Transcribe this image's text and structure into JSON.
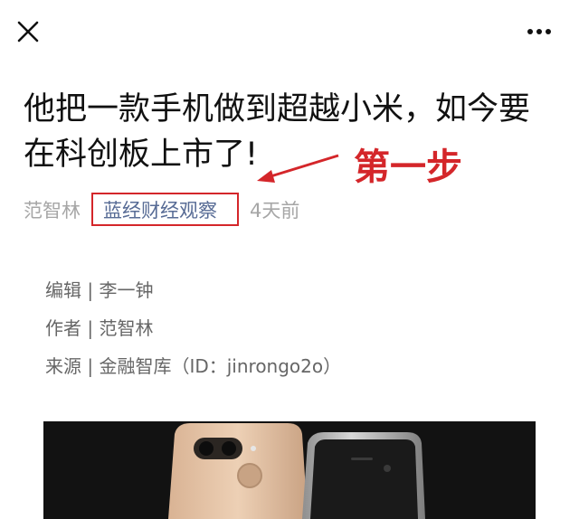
{
  "article": {
    "title": "他把一款手机做到超越小米，如今要在科创板上市了!",
    "author": "范智林",
    "account": "蓝经财经观察",
    "time": "4天前",
    "credits": [
      "编辑 | 李一钟",
      "作者 | 范智林",
      "来源 | 金融智库（ID：jinrongo2o）"
    ]
  },
  "annotation": {
    "label": "第一步",
    "color": "#d4262a"
  },
  "icons": {
    "close": "close-icon",
    "more": "more-icon"
  },
  "colors": {
    "link": "#576b95",
    "meta": "#a6a6a6",
    "text": "#111111"
  }
}
